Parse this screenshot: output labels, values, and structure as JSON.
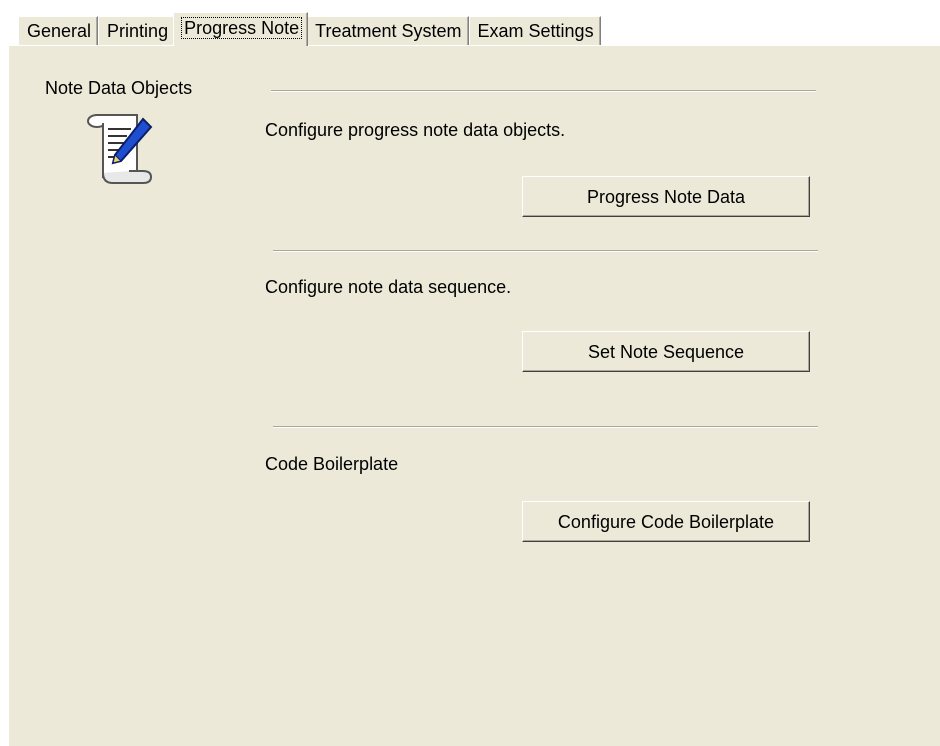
{
  "tabs": [
    {
      "label": "General"
    },
    {
      "label": "Printing"
    },
    {
      "label": "Progress Note"
    },
    {
      "label": "Treatment System"
    },
    {
      "label": "Exam Settings"
    }
  ],
  "active_tab": "Progress Note",
  "section": {
    "title": "Note Data Objects",
    "icon": "scroll-pen-icon"
  },
  "groups": [
    {
      "description": "Configure progress note data objects.",
      "button": "Progress Note Data"
    },
    {
      "description": "Configure note data sequence.",
      "button": "Set Note Sequence"
    },
    {
      "description": "Code Boilerplate",
      "button": "Configure Code Boilerplate"
    }
  ],
  "colors": {
    "panel_bg": "#ece9d8",
    "separator": "#aca899"
  }
}
